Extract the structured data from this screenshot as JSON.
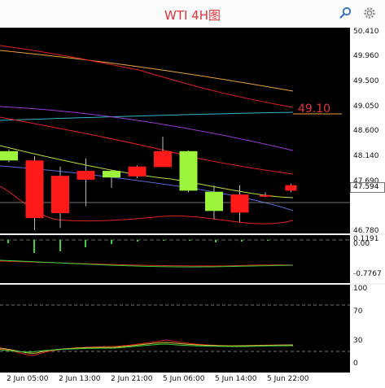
{
  "window": {
    "title": "WTI  4H图",
    "icons": [
      "search-icon",
      "settings-icon"
    ]
  },
  "chart_data": {
    "type": "candlestick",
    "symbol": "WTI",
    "timeframe": "4H",
    "title": "WTI  4H图",
    "price_axis": {
      "ticks": [
        "50.410",
        "49.960",
        "49.500",
        "49.050",
        "48.600",
        "48.140",
        "47.690",
        "47.594",
        "46.780"
      ],
      "range": [
        46.75,
        50.5
      ],
      "current_price": "47.594",
      "level_label": "49.10"
    },
    "candles": [
      {
        "o": 48.08,
        "h": 48.28,
        "l": 48.05,
        "c": 48.25
      },
      {
        "o": 48.08,
        "h": 48.16,
        "l": 46.81,
        "c": 47.03
      },
      {
        "o": 47.8,
        "h": 47.97,
        "l": 46.85,
        "c": 47.12
      },
      {
        "o": 47.89,
        "h": 48.12,
        "l": 47.25,
        "c": 47.73
      },
      {
        "o": 47.77,
        "h": 47.91,
        "l": 47.58,
        "c": 47.89
      },
      {
        "o": 47.97,
        "h": 47.99,
        "l": 47.76,
        "c": 47.79
      },
      {
        "o": 48.25,
        "h": 48.51,
        "l": 48.02,
        "c": 47.96
      },
      {
        "o": 47.53,
        "h": 48.26,
        "l": 47.5,
        "c": 48.25
      },
      {
        "o": 47.16,
        "h": 47.62,
        "l": 47.01,
        "c": 47.51
      },
      {
        "o": 47.46,
        "h": 47.63,
        "l": 46.96,
        "c": 47.13
      },
      {
        "o": 47.45,
        "h": 47.5,
        "l": 47.41,
        "c": 47.43
      },
      {
        "o": 47.63,
        "h": 47.66,
        "l": 47.5,
        "c": 47.53
      }
    ],
    "x_labels": [
      "2 Jun 05:00",
      "2 Jun 13:00",
      "2 Jun 21:00",
      "5 Jun 06:00",
      "5 Jun 14:00",
      "5 Jun 22:00"
    ],
    "macd": {
      "ticks": [
        "0.1191",
        "0.00",
        "-0.7767"
      ],
      "range": [
        -0.9,
        0.2
      ]
    },
    "rsi": {
      "ticks": [
        "100",
        "70",
        "30",
        "0"
      ],
      "levels": [
        70,
        30
      ],
      "range": [
        0,
        100
      ]
    },
    "colors": {
      "bull": "#9cf53a",
      "bear": "#ff1a1a",
      "background": "#000000",
      "title": "#e0323c"
    }
  }
}
